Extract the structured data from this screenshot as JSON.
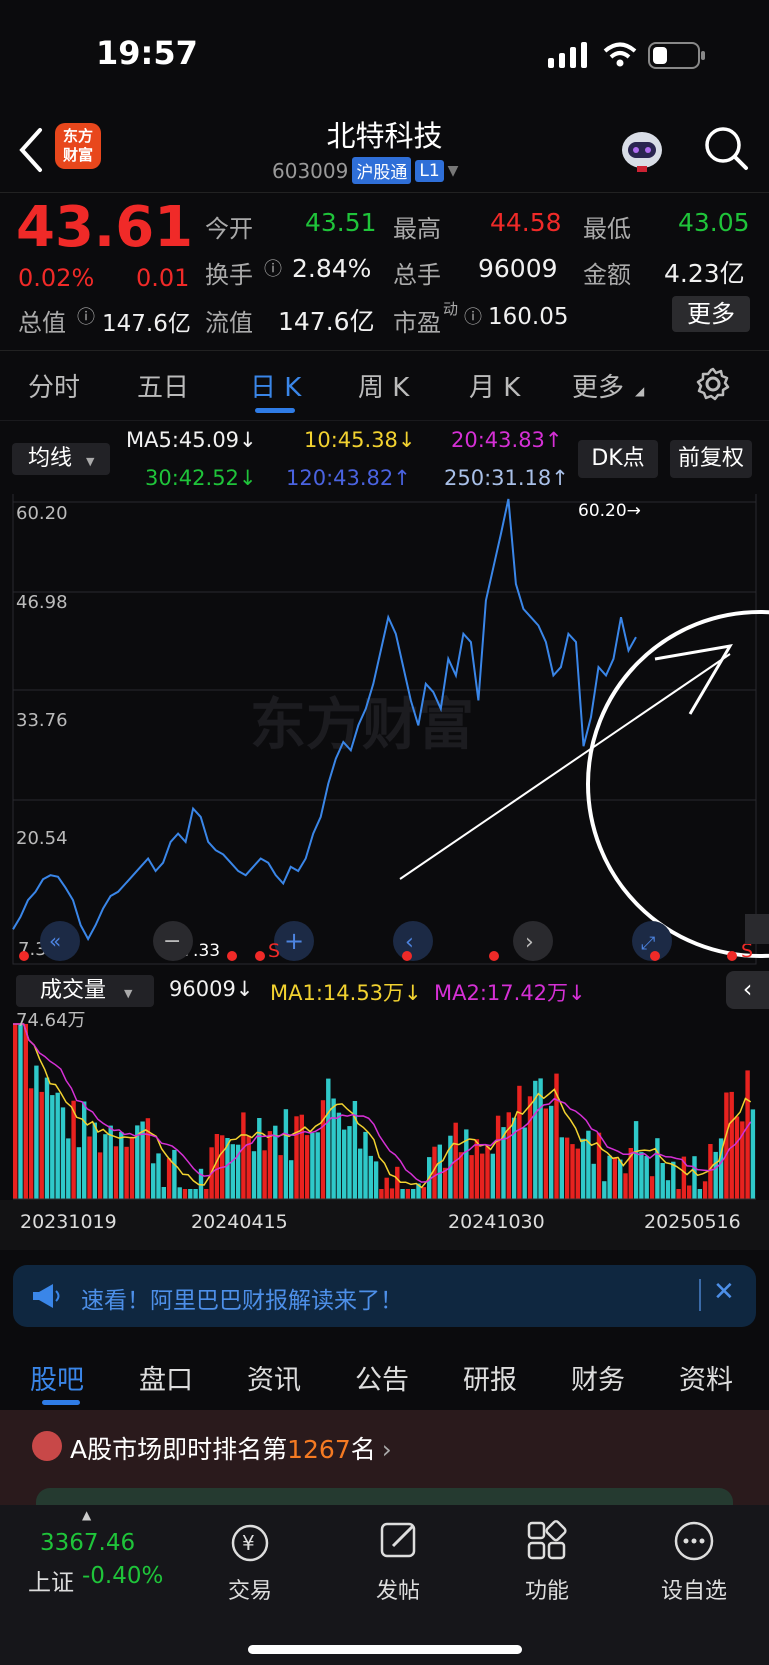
{
  "status": {
    "time": "19:57"
  },
  "header": {
    "logo_line1": "东方",
    "logo_line2": "财富",
    "name": "北特科技",
    "code": "603009",
    "market_tag": "沪股通",
    "level_tag": "L1"
  },
  "quote": {
    "price": "43.61",
    "change_pct": "0.02%",
    "change_val": "0.01",
    "open_label": "今开",
    "open": "43.51",
    "high_label": "最高",
    "high": "44.58",
    "low_label": "最低",
    "low": "43.05",
    "turnover_label": "换手",
    "turnover": "2.84%",
    "volume_label": "总手",
    "volume": "96009",
    "amount_label": "金额",
    "amount": "4.23亿",
    "total_cap_label": "总值",
    "total_cap": "147.6亿",
    "float_cap_label": "流值",
    "float_cap": "147.6亿",
    "pe_label": "市盈",
    "pe_sup": "动",
    "pe": "160.05",
    "more": "更多"
  },
  "period_tabs": [
    "分时",
    "五日",
    "日 K",
    "周 K",
    "月 K",
    "更多"
  ],
  "ma": {
    "selector": "均线",
    "ma5": "MA5:45.09↓",
    "ma10": "10:45.38↓",
    "ma20": "20:43.83↑",
    "ma30": "30:42.52↓",
    "ma120": "120:43.82↑",
    "ma250": "250:31.18↑",
    "dk": "DK点",
    "adjust": "前复权"
  },
  "chart_labels": {
    "y1": "60.20",
    "y2": "46.98",
    "y3": "33.76",
    "y4": "20.54",
    "max_mark": "60.20→",
    "min_mark": "←7.33",
    "min_left": "7.33",
    "watermark": "东方财富"
  },
  "volume": {
    "selector": "成交量",
    "vol": "96009↓",
    "ma1": "MA1:14.53万↓",
    "ma2": "MA2:17.42万↓",
    "max": "74.64万",
    "dates": [
      "20231019",
      "20240415",
      "20241030",
      "20250516"
    ]
  },
  "notice": {
    "text": "速看！阿里巴巴财报解读来了！"
  },
  "bottom_tabs": [
    "股吧",
    "盘口",
    "资讯",
    "公告",
    "研报",
    "财务",
    "资料"
  ],
  "rank": {
    "prefix": "A股市场即时排名第",
    "num": "1267",
    "suffix": "名"
  },
  "index": {
    "value": "3367.46",
    "name": "上证",
    "pct": "-0.40%"
  },
  "nav": [
    "交易",
    "发帖",
    "功能",
    "设自选"
  ],
  "colors": {
    "red": "#f02a28",
    "green": "#1fc43a",
    "blue": "#3a86e8",
    "accent": "#2f7ce6"
  },
  "chart_data": {
    "type": "line",
    "title": "",
    "xlabel": "",
    "ylabel": "",
    "ylim": [
      7.33,
      60.2
    ],
    "x_ticks": [
      "20231019",
      "20240415",
      "20241030",
      "20250516"
    ],
    "series": [
      {
        "values": [
          8.5,
          10,
          12,
          13,
          14.5,
          15,
          14.8,
          13.5,
          12,
          9,
          7.33,
          9,
          11,
          12.5,
          13,
          14,
          15,
          16,
          17,
          15.5,
          16.5,
          19,
          20,
          19,
          23,
          22,
          19,
          18,
          17.5,
          16.5,
          15.5,
          15,
          16,
          17,
          16.5,
          15,
          14,
          16,
          15.5,
          17,
          20,
          22,
          26,
          29,
          31,
          30,
          33,
          35,
          38,
          42,
          46,
          44,
          40,
          36,
          33,
          38,
          37,
          35,
          41,
          39,
          44,
          43,
          36,
          48,
          52,
          56,
          60.2,
          50,
          47,
          46,
          45,
          43,
          39,
          40,
          44,
          43,
          30.5,
          34,
          40,
          39,
          41,
          46,
          42,
          43.61
        ]
      }
    ]
  }
}
